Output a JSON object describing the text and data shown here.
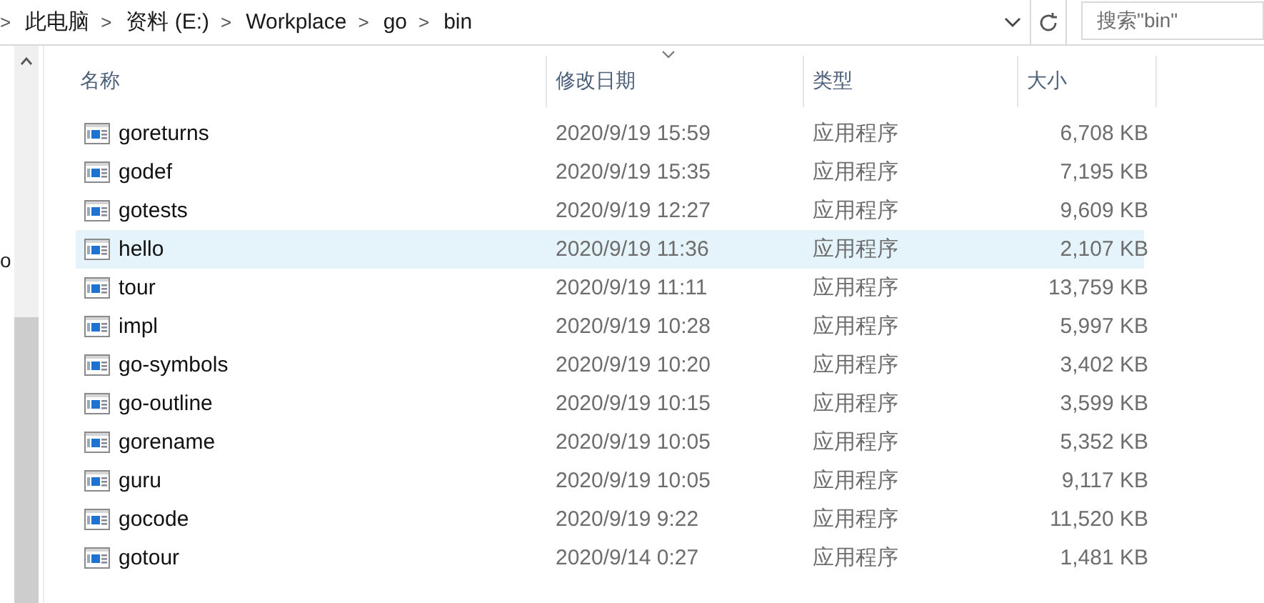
{
  "address_bar": {
    "separator": ">",
    "crumbs": [
      "此电脑",
      "资料 (E:)",
      "Workplace",
      "go",
      "bin"
    ]
  },
  "search": {
    "placeholder": "搜索\"bin\""
  },
  "nav_pane": {
    "text": "o"
  },
  "table": {
    "columns": [
      {
        "label": "名称",
        "sorted": false
      },
      {
        "label": "修改日期",
        "sorted": true
      },
      {
        "label": "类型",
        "sorted": false
      },
      {
        "label": "大小",
        "sorted": false
      }
    ],
    "rows": [
      {
        "name": "goreturns",
        "date": "2020/9/19 15:59",
        "type": "应用程序",
        "size": "6,708 KB",
        "selected": false
      },
      {
        "name": "godef",
        "date": "2020/9/19 15:35",
        "type": "应用程序",
        "size": "7,195 KB",
        "selected": false
      },
      {
        "name": "gotests",
        "date": "2020/9/19 12:27",
        "type": "应用程序",
        "size": "9,609 KB",
        "selected": false
      },
      {
        "name": "hello",
        "date": "2020/9/19 11:36",
        "type": "应用程序",
        "size": "2,107 KB",
        "selected": true
      },
      {
        "name": "tour",
        "date": "2020/9/19 11:11",
        "type": "应用程序",
        "size": "13,759 KB",
        "selected": false
      },
      {
        "name": "impl",
        "date": "2020/9/19 10:28",
        "type": "应用程序",
        "size": "5,997 KB",
        "selected": false
      },
      {
        "name": "go-symbols",
        "date": "2020/9/19 10:20",
        "type": "应用程序",
        "size": "3,402 KB",
        "selected": false
      },
      {
        "name": "go-outline",
        "date": "2020/9/19 10:15",
        "type": "应用程序",
        "size": "3,599 KB",
        "selected": false
      },
      {
        "name": "gorename",
        "date": "2020/9/19 10:05",
        "type": "应用程序",
        "size": "5,352 KB",
        "selected": false
      },
      {
        "name": "guru",
        "date": "2020/9/19 10:05",
        "type": "应用程序",
        "size": "9,117 KB",
        "selected": false
      },
      {
        "name": "gocode",
        "date": "2020/9/19 9:22",
        "type": "应用程序",
        "size": "11,520 KB",
        "selected": false
      },
      {
        "name": "gotour",
        "date": "2020/9/14 0:27",
        "type": "应用程序",
        "size": "1,481 KB",
        "selected": false
      }
    ]
  }
}
